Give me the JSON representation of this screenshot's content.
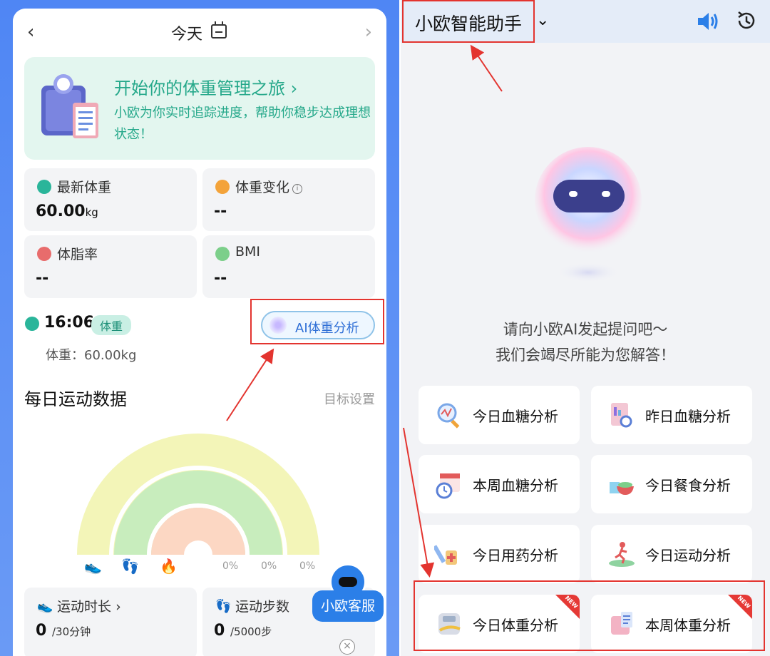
{
  "left": {
    "nav": {
      "back": "‹",
      "title": "今天",
      "forward": "›"
    },
    "banner": {
      "title": "开始你的体重管理之旅",
      "arrow": "›",
      "subtitle": "小欧为你实时追踪进度，帮助你稳步达成理想状态！"
    },
    "metrics": [
      {
        "label": "最新体重",
        "value": "60.00",
        "unit": "kg",
        "color": "#2ab59a"
      },
      {
        "label": "体重变化",
        "value": "--",
        "unit": "",
        "color": "#f3a33a"
      },
      {
        "label": "体脂率",
        "value": "--",
        "unit": "",
        "color": "#e86c6c"
      },
      {
        "label": "BMI",
        "value": "--",
        "unit": "",
        "color": "#7ccf8a"
      }
    ],
    "record": {
      "time": "16:06",
      "badge": "体重",
      "detail": "体重：60.00kg"
    },
    "ai_button": "AI体重分析",
    "section": {
      "title": "每日运动数据",
      "link": "目标设置"
    },
    "rings": {
      "percents": [
        "0%",
        "0%",
        "0%"
      ],
      "values": [
        0,
        0,
        0
      ]
    },
    "cards": [
      {
        "icon": "shoe-icon",
        "label": "运动时长",
        "arrow": "›",
        "value": "0",
        "unit": "/30分钟"
      },
      {
        "icon": "footprint-icon",
        "label": "运动步数",
        "value": "0",
        "unit": "/5000步"
      }
    ],
    "customer_service": "小欧客服",
    "close": "×"
  },
  "right": {
    "title": "小欧智能助手",
    "caret": "⌄",
    "prompt_line1": "请向小欧AI发起提问吧～",
    "prompt_line2": "我们会竭尽所能为您解答！",
    "quick": [
      {
        "label": "今日血糖分析",
        "icon": "magnifier-chart-icon",
        "new": false
      },
      {
        "label": "昨日血糖分析",
        "icon": "report-search-icon",
        "new": false
      },
      {
        "label": "本周血糖分析",
        "icon": "calendar-clock-icon",
        "new": false
      },
      {
        "label": "今日餐食分析",
        "icon": "meal-icon",
        "new": false
      },
      {
        "label": "今日用药分析",
        "icon": "medicine-icon",
        "new": false
      },
      {
        "label": "今日运动分析",
        "icon": "runner-icon",
        "new": false
      },
      {
        "label": "今日体重分析",
        "icon": "scale-icon",
        "new": true
      },
      {
        "label": "本周体重分析",
        "icon": "weekly-scale-icon",
        "new": true
      }
    ],
    "new_badge": "NEW"
  },
  "colors": {
    "accent_blue": "#2b7fe8",
    "green": "#25a88a",
    "highlight_red": "#e3342f"
  }
}
